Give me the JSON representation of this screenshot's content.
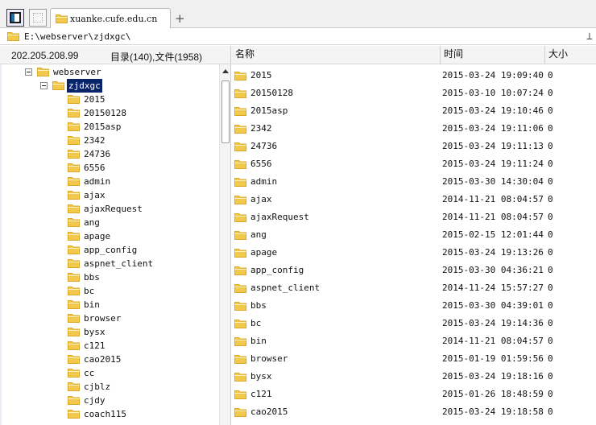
{
  "tabs": [
    {
      "label": "xuanke.cufe.edu.cn"
    }
  ],
  "address": {
    "path": "E:\\webserver\\zjdxgc\\"
  },
  "stats": {
    "ip": "202.205.208.99",
    "summary": "目录(140),文件(1958)"
  },
  "columns": {
    "name": "名称",
    "time": "时间",
    "size": "大小"
  },
  "tree": [
    {
      "label": "webserver",
      "level": 0,
      "expanded": true
    },
    {
      "label": "zjdxgc",
      "level": 1,
      "expanded": true,
      "selected": true
    },
    {
      "label": "2015",
      "level": 2
    },
    {
      "label": "20150128",
      "level": 2
    },
    {
      "label": "2015asp",
      "level": 2
    },
    {
      "label": "2342",
      "level": 2
    },
    {
      "label": "24736",
      "level": 2
    },
    {
      "label": "6556",
      "level": 2
    },
    {
      "label": "admin",
      "level": 2
    },
    {
      "label": "ajax",
      "level": 2
    },
    {
      "label": "ajaxRequest",
      "level": 2
    },
    {
      "label": "ang",
      "level": 2
    },
    {
      "label": "apage",
      "level": 2
    },
    {
      "label": "app_config",
      "level": 2
    },
    {
      "label": "aspnet_client",
      "level": 2
    },
    {
      "label": "bbs",
      "level": 2
    },
    {
      "label": "bc",
      "level": 2
    },
    {
      "label": "bin",
      "level": 2
    },
    {
      "label": "browser",
      "level": 2
    },
    {
      "label": "bysx",
      "level": 2
    },
    {
      "label": "c121",
      "level": 2
    },
    {
      "label": "cao2015",
      "level": 2
    },
    {
      "label": "cc",
      "level": 2
    },
    {
      "label": "cjblz",
      "level": 2
    },
    {
      "label": "cjdy",
      "level": 2
    },
    {
      "label": "coach115",
      "level": 2
    }
  ],
  "files": [
    {
      "name": "2015",
      "time": "2015-03-24 19:09:40",
      "size": "0"
    },
    {
      "name": "20150128",
      "time": "2015-03-10 10:07:24",
      "size": "0"
    },
    {
      "name": "2015asp",
      "time": "2015-03-24 19:10:46",
      "size": "0"
    },
    {
      "name": "2342",
      "time": "2015-03-24 19:11:06",
      "size": "0"
    },
    {
      "name": "24736",
      "time": "2015-03-24 19:11:13",
      "size": "0"
    },
    {
      "name": "6556",
      "time": "2015-03-24 19:11:24",
      "size": "0"
    },
    {
      "name": "admin",
      "time": "2015-03-30 14:30:04",
      "size": "0"
    },
    {
      "name": "ajax",
      "time": "2014-11-21 08:04:57",
      "size": "0"
    },
    {
      "name": "ajaxRequest",
      "time": "2014-11-21 08:04:57",
      "size": "0"
    },
    {
      "name": "ang",
      "time": "2015-02-15 12:01:44",
      "size": "0"
    },
    {
      "name": "apage",
      "time": "2015-03-24 19:13:26",
      "size": "0"
    },
    {
      "name": "app_config",
      "time": "2015-03-30 04:36:21",
      "size": "0"
    },
    {
      "name": "aspnet_client",
      "time": "2014-11-24 15:57:27",
      "size": "0"
    },
    {
      "name": "bbs",
      "time": "2015-03-30 04:39:01",
      "size": "0"
    },
    {
      "name": "bc",
      "time": "2015-03-24 19:14:36",
      "size": "0"
    },
    {
      "name": "bin",
      "time": "2014-11-21 08:04:57",
      "size": "0"
    },
    {
      "name": "browser",
      "time": "2015-01-19 01:59:56",
      "size": "0"
    },
    {
      "name": "bysx",
      "time": "2015-03-24 19:18:16",
      "size": "0"
    },
    {
      "name": "c121",
      "time": "2015-01-26 18:48:59",
      "size": "0"
    },
    {
      "name": "cao2015",
      "time": "2015-03-24 19:18:58",
      "size": "0"
    }
  ],
  "colors": {
    "selection": "#0a246a",
    "folder": "#f2c94c",
    "folder_dark": "#d9a826"
  }
}
